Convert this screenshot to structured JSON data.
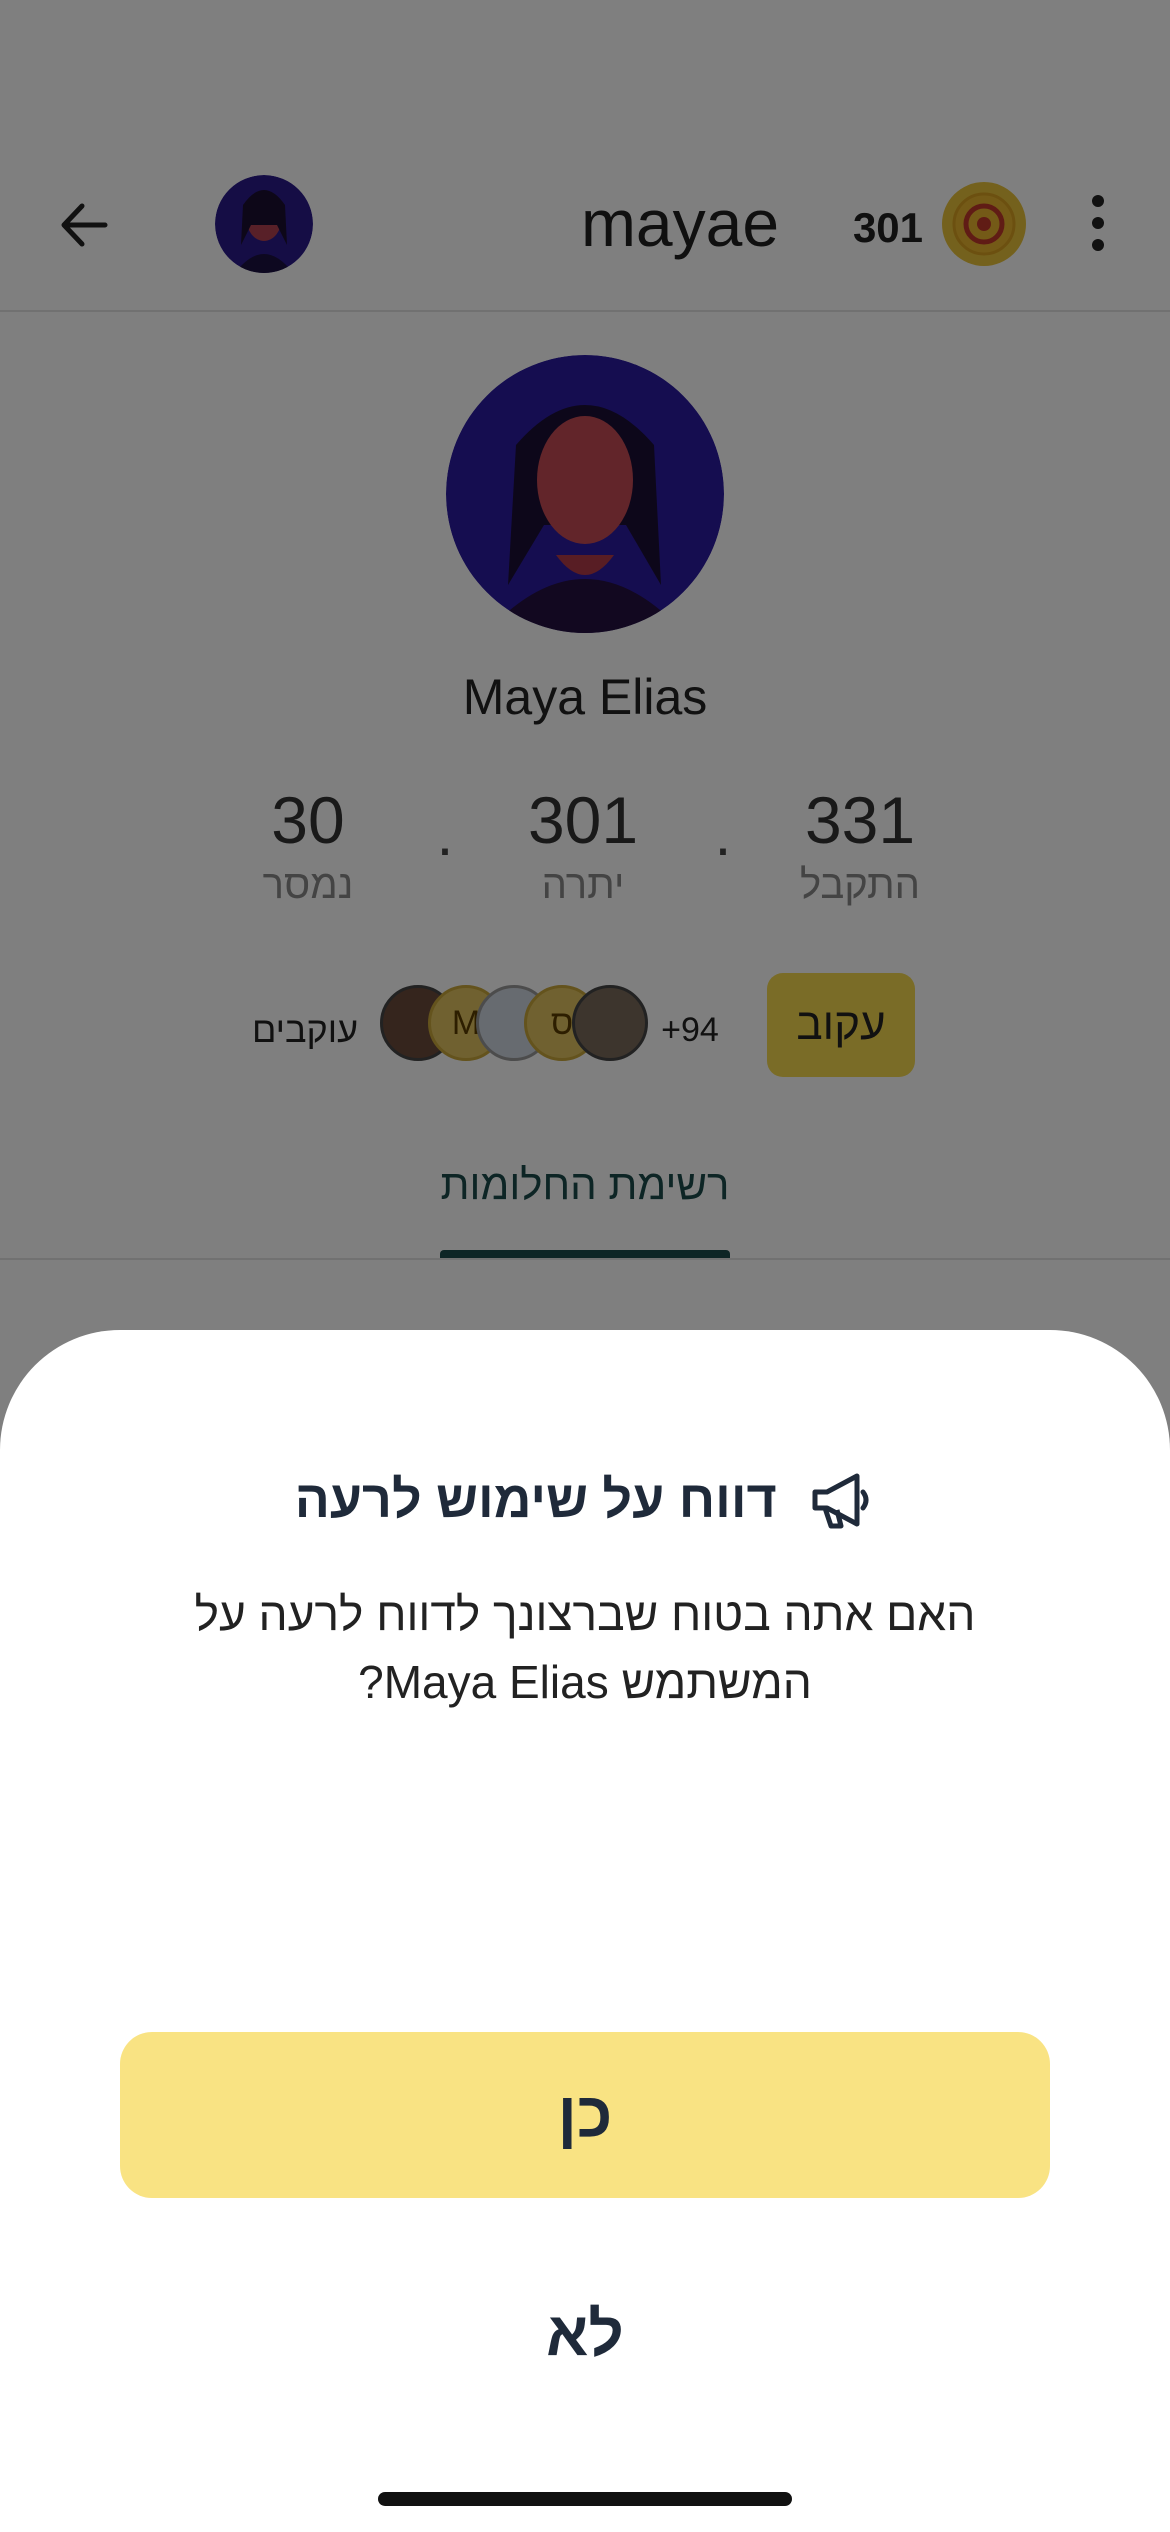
{
  "header": {
    "username": "mayae",
    "coins": "301"
  },
  "profile": {
    "name": "Maya Elias",
    "stats": [
      {
        "value": "331",
        "label": "התקבל"
      },
      {
        "value": "301",
        "label": "יתרה"
      },
      {
        "value": "30",
        "label": "נמסר"
      }
    ],
    "followers_label": "עוקבים",
    "followers_more": "+94",
    "follower_initials": [
      "M",
      "ס"
    ],
    "follow_button": "עקוב",
    "tab_label": "רשימת החלומות"
  },
  "dialog": {
    "title": "דווח על שימוש לרעה",
    "message": "האם אתה בטוח שברצונך לדווח לרעה על המשתמש Maya Elias?",
    "yes_label": "כן",
    "no_label": "לא"
  },
  "colors": {
    "accent_yellow": "#f9e383",
    "follow_button": "#f5d84f",
    "text_dark": "#1f2a3a",
    "tab_teal": "#1a4a4a",
    "overlay": "rgba(0,0,0,0.5)"
  },
  "icons": [
    "back-arrow-icon",
    "coin-icon",
    "more-vertical-icon",
    "megaphone-icon"
  ]
}
